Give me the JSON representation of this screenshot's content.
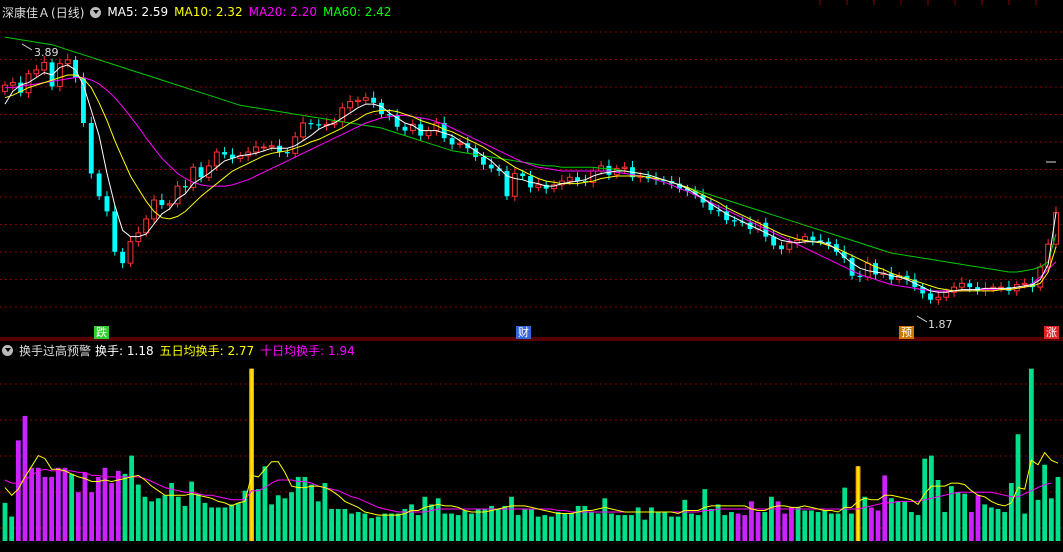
{
  "stock_name": "深康佳Ａ",
  "period": "(日线)",
  "ma_indicators": [
    {
      "label": "MA5: 2.59",
      "color": "#ffffff"
    },
    {
      "label": "MA10: 2.32",
      "color": "#ffff00"
    },
    {
      "label": "MA20: 2.20",
      "color": "#ff00ff"
    },
    {
      "label": "MA60: 2.42",
      "color": "#00ff00"
    }
  ],
  "sub_indicator": {
    "name": "换手过高预警",
    "items": [
      {
        "label": "换手: 1.18",
        "color": "#ffffff"
      },
      {
        "label": "五日均换手: 2.77",
        "color": "#ffff00"
      },
      {
        "label": "十日均换手: 1.94",
        "color": "#ff00ff"
      }
    ]
  },
  "markers": [
    {
      "text": "跌",
      "color": "#33cc33",
      "textColor": "#ffffff"
    },
    {
      "text": "财",
      "color": "#3366dd",
      "textColor": "#ffffff"
    },
    {
      "text": "预",
      "color": "#cc7700",
      "textColor": "#ffffff"
    },
    {
      "text": "涨",
      "color": "#dd2222",
      "textColor": "#ffffff"
    }
  ],
  "price_high_label": "3.89",
  "price_low_label": "1.87",
  "colors": {
    "up": "#ff3333",
    "down": "#00ffff",
    "vol_green": "#00e08a",
    "vol_purple": "#cc22ff",
    "vol_orange": "#ffaa00",
    "grid": "#8b0000",
    "ma5": "#ffffff",
    "ma10": "#ffff00",
    "ma20": "#ff00ff",
    "ma60": "#00cc00"
  },
  "chart_data": [
    {
      "type": "candlestick",
      "title": "深康佳Ａ (日线)",
      "ylim": [
        1.7,
        4.1
      ],
      "close": [
        3.6,
        3.62,
        3.54,
        3.69,
        3.72,
        3.78,
        3.59,
        3.77,
        3.8,
        3.66,
        3.3,
        2.9,
        2.72,
        2.6,
        2.28,
        2.19,
        2.36,
        2.43,
        2.54,
        2.69,
        2.65,
        2.66,
        2.8,
        2.79,
        2.95,
        2.87,
        2.96,
        3.07,
        3.05,
        3.02,
        3.04,
        3.07,
        3.11,
        3.11,
        3.12,
        3.07,
        3.06,
        3.19,
        3.3,
        3.29,
        3.28,
        3.29,
        3.31,
        3.42,
        3.47,
        3.48,
        3.5,
        3.46,
        3.37,
        3.36,
        3.27,
        3.24,
        3.29,
        3.2,
        3.24,
        3.3,
        3.18,
        3.13,
        3.14,
        3.1,
        3.03,
        2.97,
        2.94,
        2.92,
        2.72,
        2.9,
        2.88,
        2.79,
        2.81,
        2.78,
        2.81,
        2.84,
        2.87,
        2.84,
        2.83,
        2.92,
        2.96,
        2.89,
        2.94,
        2.95,
        2.87,
        2.88,
        2.86,
        2.85,
        2.84,
        2.82,
        2.78,
        2.76,
        2.73,
        2.67,
        2.61,
        2.6,
        2.53,
        2.52,
        2.51,
        2.46,
        2.51,
        2.4,
        2.33,
        2.3,
        2.35,
        2.37,
        2.4,
        2.37,
        2.36,
        2.34,
        2.28,
        2.23,
        2.09,
        2.08,
        2.19,
        2.1,
        2.11,
        2.06,
        2.09,
        2.06,
        2.0,
        1.95,
        1.9,
        1.92,
        1.96,
        2.0,
        2.03,
        2.0,
        1.97,
        1.99,
        2.0,
        2.0,
        1.97,
        2.02,
        2.03,
        2.0,
        2.16,
        2.34,
        2.59
      ],
      "ma5": [
        3.45,
        3.55,
        3.6,
        3.62,
        3.66,
        3.7,
        3.68,
        3.74,
        3.76,
        3.72,
        3.6,
        3.4,
        3.2,
        2.9,
        2.65,
        2.45,
        2.4,
        2.4,
        2.42,
        2.5,
        2.58,
        2.62,
        2.7,
        2.74,
        2.82,
        2.86,
        2.9,
        2.95,
        3.0,
        3.02,
        3.04,
        3.05,
        3.06,
        3.08,
        3.1,
        3.1,
        3.1,
        3.12,
        3.16,
        3.2,
        3.25,
        3.28,
        3.3,
        3.34,
        3.38,
        3.42,
        3.45,
        3.45,
        3.43,
        3.38,
        3.34,
        3.3,
        3.28,
        3.24,
        3.24,
        3.24,
        3.22,
        3.2,
        3.16,
        3.12,
        3.08,
        3.04,
        3.0,
        2.94,
        2.88,
        2.86,
        2.85,
        2.83,
        2.82,
        2.8,
        2.8,
        2.82,
        2.83,
        2.84,
        2.85,
        2.88,
        2.9,
        2.91,
        2.92,
        2.92,
        2.91,
        2.9,
        2.89,
        2.87,
        2.85,
        2.83,
        2.81,
        2.78,
        2.74,
        2.7,
        2.66,
        2.62,
        2.58,
        2.55,
        2.52,
        2.49,
        2.46,
        2.43,
        2.4,
        2.37,
        2.36,
        2.35,
        2.36,
        2.36,
        2.36,
        2.34,
        2.3,
        2.24,
        2.19,
        2.15,
        2.13,
        2.12,
        2.11,
        2.09,
        2.08,
        2.06,
        2.03,
        2.0,
        1.97,
        1.96,
        1.96,
        1.97,
        1.98,
        1.98,
        1.98,
        1.99,
        1.99,
        1.99,
        1.99,
        2.0,
        2.01,
        2.02,
        2.06,
        2.18,
        2.59
      ],
      "ma10": [
        3.5,
        3.52,
        3.55,
        3.58,
        3.6,
        3.62,
        3.64,
        3.66,
        3.68,
        3.68,
        3.65,
        3.58,
        3.46,
        3.32,
        3.16,
        3.02,
        2.88,
        2.78,
        2.68,
        2.6,
        2.55,
        2.54,
        2.56,
        2.6,
        2.66,
        2.72,
        2.77,
        2.82,
        2.87,
        2.92,
        2.95,
        2.98,
        3.01,
        3.04,
        3.06,
        3.07,
        3.08,
        3.1,
        3.12,
        3.15,
        3.17,
        3.2,
        3.23,
        3.26,
        3.3,
        3.33,
        3.37,
        3.39,
        3.4,
        3.4,
        3.39,
        3.37,
        3.35,
        3.32,
        3.3,
        3.28,
        3.25,
        3.23,
        3.2,
        3.17,
        3.14,
        3.11,
        3.07,
        3.03,
        2.99,
        2.95,
        2.92,
        2.89,
        2.86,
        2.84,
        2.83,
        2.82,
        2.82,
        2.82,
        2.83,
        2.84,
        2.86,
        2.87,
        2.88,
        2.88,
        2.88,
        2.88,
        2.87,
        2.86,
        2.85,
        2.83,
        2.81,
        2.79,
        2.76,
        2.73,
        2.7,
        2.67,
        2.63,
        2.6,
        2.57,
        2.54,
        2.51,
        2.48,
        2.45,
        2.42,
        2.4,
        2.38,
        2.37,
        2.36,
        2.35,
        2.33,
        2.31,
        2.28,
        2.25,
        2.22,
        2.19,
        2.16,
        2.14,
        2.11,
        2.09,
        2.07,
        2.05,
        2.03,
        2.01,
        1.99,
        1.98,
        1.97,
        1.97,
        1.97,
        1.97,
        1.97,
        1.97,
        1.98,
        1.98,
        1.99,
        2.0,
        2.01,
        2.03,
        2.12,
        2.32
      ],
      "ma20": [
        3.58,
        3.58,
        3.59,
        3.6,
        3.61,
        3.62,
        3.63,
        3.64,
        3.65,
        3.66,
        3.66,
        3.64,
        3.61,
        3.56,
        3.5,
        3.43,
        3.35,
        3.27,
        3.18,
        3.1,
        3.02,
        2.96,
        2.9,
        2.86,
        2.83,
        2.81,
        2.8,
        2.8,
        2.8,
        2.81,
        2.83,
        2.85,
        2.88,
        2.91,
        2.94,
        2.97,
        3.0,
        3.03,
        3.06,
        3.09,
        3.12,
        3.15,
        3.18,
        3.21,
        3.24,
        3.27,
        3.3,
        3.32,
        3.34,
        3.35,
        3.36,
        3.36,
        3.35,
        3.34,
        3.33,
        3.31,
        3.29,
        3.26,
        3.23,
        3.2,
        3.17,
        3.14,
        3.11,
        3.08,
        3.05,
        3.02,
        2.99,
        2.97,
        2.95,
        2.94,
        2.93,
        2.92,
        2.92,
        2.92,
        2.92,
        2.92,
        2.92,
        2.92,
        2.91,
        2.9,
        2.89,
        2.88,
        2.87,
        2.85,
        2.83,
        2.81,
        2.78,
        2.76,
        2.73,
        2.7,
        2.67,
        2.64,
        2.61,
        2.58,
        2.55,
        2.52,
        2.49,
        2.46,
        2.43,
        2.4,
        2.37,
        2.34,
        2.31,
        2.28,
        2.25,
        2.22,
        2.19,
        2.16,
        2.13,
        2.1,
        2.08,
        2.06,
        2.04,
        2.02,
        2.01,
        2.0,
        1.99,
        1.98,
        1.97,
        1.97,
        1.97,
        1.97,
        1.97,
        1.98,
        1.98,
        1.98,
        1.98,
        1.98,
        1.98,
        1.99,
        2.0,
        2.03,
        2.08,
        2.14,
        2.2
      ],
      "ma60": [
        3.98,
        3.97,
        3.96,
        3.95,
        3.94,
        3.93,
        3.92,
        3.9,
        3.88,
        3.86,
        3.84,
        3.82,
        3.8,
        3.78,
        3.76,
        3.74,
        3.72,
        3.7,
        3.68,
        3.66,
        3.64,
        3.62,
        3.6,
        3.58,
        3.56,
        3.54,
        3.52,
        3.5,
        3.48,
        3.46,
        3.44,
        3.43,
        3.42,
        3.41,
        3.4,
        3.39,
        3.38,
        3.37,
        3.36,
        3.35,
        3.34,
        3.33,
        3.32,
        3.31,
        3.3,
        3.29,
        3.28,
        3.27,
        3.26,
        3.24,
        3.22,
        3.2,
        3.18,
        3.16,
        3.14,
        3.12,
        3.1,
        3.08,
        3.07,
        3.06,
        3.05,
        3.04,
        3.03,
        3.02,
        3.01,
        3.0,
        2.99,
        2.98,
        2.97,
        2.96,
        2.96,
        2.95,
        2.95,
        2.95,
        2.95,
        2.95,
        2.94,
        2.94,
        2.93,
        2.92,
        2.91,
        2.9,
        2.89,
        2.87,
        2.85,
        2.83,
        2.81,
        2.79,
        2.77,
        2.75,
        2.73,
        2.71,
        2.69,
        2.67,
        2.65,
        2.63,
        2.61,
        2.59,
        2.57,
        2.55,
        2.53,
        2.51,
        2.49,
        2.47,
        2.45,
        2.43,
        2.41,
        2.39,
        2.37,
        2.35,
        2.33,
        2.31,
        2.29,
        2.27,
        2.26,
        2.25,
        2.24,
        2.23,
        2.22,
        2.21,
        2.2,
        2.19,
        2.18,
        2.17,
        2.16,
        2.15,
        2.14,
        2.13,
        2.12,
        2.12,
        2.13,
        2.14,
        2.16,
        2.2,
        2.42
      ]
    },
    {
      "type": "bar",
      "title": "换手过高预警",
      "ylim": [
        0,
        12
      ],
      "values": [
        2.5,
        1.6,
        6.6,
        8.2,
        4.8,
        4.8,
        4.2,
        4.2,
        4.8,
        4.8,
        4.4,
        3.2,
        4.5,
        3.2,
        4.2,
        4.8,
        3.8,
        4.6,
        4.4,
        5.6,
        3.7,
        2.9,
        2.6,
        2.8,
        3.0,
        3.8,
        2.9,
        2.3,
        3.9,
        3.1,
        2.5,
        2.2,
        2.2,
        2.2,
        2.4,
        2.5,
        3.3,
        11.3,
        3.4,
        4.9,
        2.4,
        3.0,
        2.8,
        3.2,
        4.2,
        4.2,
        3.7,
        2.6,
        3.8,
        2.1,
        2.1,
        2.1,
        1.8,
        1.9,
        1.8,
        1.5,
        1.6,
        1.8,
        1.8,
        1.8,
        2.1,
        2.4,
        1.7,
        2.9,
        2.4,
        2.8,
        1.8,
        1.8,
        1.7,
        2.0,
        1.8,
        2.1,
        2.1,
        2.3,
        2.1,
        2.3,
        2.9,
        1.7,
        2.1,
        2.1,
        1.6,
        1.7,
        1.6,
        1.9,
        1.8,
        1.8,
        2.3,
        2.3,
        1.9,
        1.8,
        2.8,
        1.8,
        1.7,
        1.7,
        1.7,
        2.2,
        1.4,
        2.2,
        1.9,
        1.9,
        1.6,
        1.6,
        2.7,
        1.8,
        1.7,
        3.4,
        2.1,
        2.4,
        1.7,
        1.9,
        1.8,
        1.7,
        2.6,
        1.9,
        1.9,
        2.9,
        2.6,
        1.8,
        2.2,
        2.2,
        2.0,
        2.0,
        1.9,
        2.0,
        1.8,
        1.8,
        3.5,
        1.8,
        4.9,
        2.9,
        2.2,
        2.0,
        4.3,
        2.8,
        2.6,
        2.6,
        1.9,
        1.7,
        5.4,
        5.6,
        4.0,
        1.9,
        3.6,
        3.2,
        3.1,
        1.9,
        3.0,
        2.4,
        2.2,
        2.1,
        1.9,
        3.8,
        7.0,
        1.8,
        11.3,
        2.7,
        5.0,
        2.8,
        4.2
      ],
      "highlight": {
        "purple": [
          2,
          3,
          4,
          5,
          6,
          7,
          8,
          9,
          11,
          12,
          13,
          14,
          15,
          16,
          17,
          110,
          111,
          112,
          113,
          116,
          117,
          118,
          130,
          131,
          132,
          145,
          146
        ],
        "orange": [
          37,
          128
        ]
      },
      "ma5": [
        3.5,
        3.0,
        3.4,
        4.2,
        4.9,
        5.6,
        5.4,
        4.7,
        4.7,
        4.6,
        4.4,
        4.2,
        4.1,
        3.9,
        3.9,
        4.0,
        3.9,
        4.0,
        4.1,
        4.2,
        4.3,
        4.0,
        3.6,
        3.3,
        3.0,
        3.0,
        3.0,
        3.0,
        3.1,
        3.0,
        2.9,
        2.8,
        2.6,
        2.5,
        2.3,
        2.5,
        2.6,
        4.3,
        4.2,
        4.7,
        5.2,
        5.2,
        4.5,
        3.6,
        3.5,
        3.5,
        3.6,
        3.6,
        3.5,
        3.3,
        3.0,
        2.6,
        2.4,
        2.2,
        1.9,
        1.8,
        1.7,
        1.7,
        1.7,
        1.7,
        1.8,
        2.0,
        2.0,
        2.2,
        2.3,
        2.4,
        2.3,
        2.3,
        2.2,
        2.0,
        1.9,
        1.9,
        1.9,
        2.0,
        2.1,
        2.2,
        2.3,
        2.3,
        2.3,
        2.2,
        2.1,
        2.0,
        1.9,
        1.8,
        1.8,
        1.8,
        1.9,
        2.0,
        2.0,
        2.1,
        2.2,
        2.1,
        2.0,
        1.9,
        1.9,
        1.9,
        1.9,
        1.9,
        1.9,
        1.9,
        1.9,
        1.8,
        2.0,
        2.0,
        2.0,
        2.2,
        2.3,
        2.3,
        2.3,
        2.3,
        2.3,
        2.3,
        2.1,
        2.0,
        2.0,
        2.2,
        2.3,
        2.3,
        2.2,
        2.2,
        2.3,
        2.2,
        2.1,
        2.0,
        2.0,
        1.9,
        2.2,
        2.2,
        2.6,
        2.8,
        2.7,
        2.7,
        3.0,
        3.0,
        2.9,
        2.8,
        2.7,
        2.4,
        3.1,
        3.6,
        3.6,
        3.6,
        3.8,
        3.8,
        3.7,
        3.3,
        3.0,
        2.9,
        2.6,
        2.4,
        2.3,
        2.5,
        3.5,
        3.4,
        5.3,
        5.0,
        5.8,
        5.3,
        5.1
      ],
      "ma10": [
        4.0,
        3.8,
        3.8,
        4.0,
        4.3,
        4.6,
        4.7,
        4.6,
        4.6,
        4.6,
        4.6,
        4.5,
        4.5,
        4.3,
        4.3,
        4.2,
        4.2,
        4.2,
        4.2,
        4.2,
        4.2,
        4.1,
        3.9,
        3.7,
        3.5,
        3.4,
        3.3,
        3.2,
        3.2,
        3.1,
        3.0,
        3.0,
        2.9,
        2.8,
        2.7,
        2.7,
        2.7,
        3.3,
        3.3,
        3.5,
        3.8,
        4.0,
        4.0,
        4.0,
        3.9,
        3.9,
        3.8,
        3.6,
        3.5,
        3.4,
        3.3,
        3.1,
        2.9,
        2.8,
        2.6,
        2.4,
        2.2,
        2.1,
        2.0,
        1.9,
        1.9,
        1.9,
        1.9,
        1.9,
        2.0,
        2.1,
        2.1,
        2.1,
        2.1,
        2.1,
        2.1,
        2.1,
        2.1,
        2.1,
        2.1,
        2.1,
        2.1,
        2.1,
        2.1,
        2.1,
        2.1,
        2.1,
        2.1,
        2.0,
        2.0,
        1.9,
        1.9,
        1.9,
        1.9,
        1.9,
        1.9,
        1.9,
        1.9,
        1.9,
        1.9,
        1.9,
        1.9,
        1.9,
        1.9,
        1.9,
        1.9,
        1.9,
        1.9,
        1.9,
        1.9,
        2.0,
        2.0,
        2.1,
        2.1,
        2.1,
        2.1,
        2.1,
        2.1,
        2.1,
        2.1,
        2.1,
        2.1,
        2.1,
        2.1,
        2.1,
        2.1,
        2.1,
        2.1,
        2.1,
        2.1,
        2.1,
        2.1,
        2.1,
        2.1,
        2.2,
        2.3,
        2.4,
        2.5,
        2.5,
        2.6,
        2.6,
        2.6,
        2.6,
        2.7,
        2.8,
        2.9,
        3.0,
        3.1,
        3.2,
        3.2,
        3.2,
        3.2,
        3.2,
        3.2,
        3.1,
        3.0,
        2.9,
        2.9,
        3.1,
        3.3,
        3.5,
        3.7,
        3.8
      ]
    }
  ]
}
